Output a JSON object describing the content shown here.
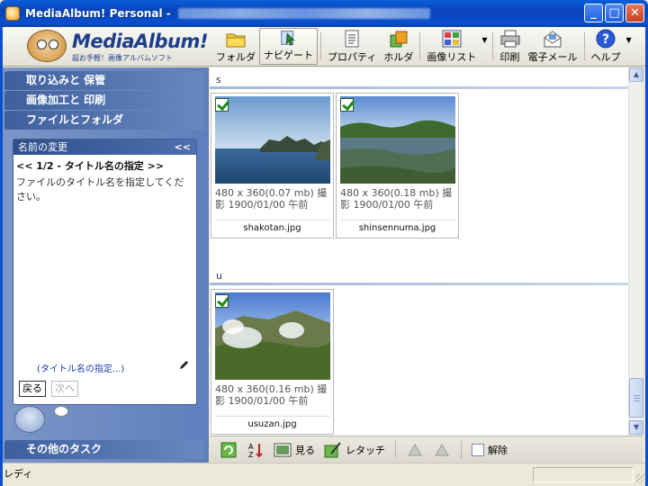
{
  "window": {
    "title": "MediaAlbum! Personal -",
    "minimize": "_",
    "maximize": "□",
    "close": "✕"
  },
  "logo": {
    "text": "MediaAlbum!",
    "subtitle": "超お手軽！画像アルバムソフト"
  },
  "toolbar": {
    "folder": "フォルダ",
    "navigate": "ナビゲート",
    "properties": "プロパティ",
    "holder": "ホルダ",
    "image_list": "画像リスト",
    "print": "印刷",
    "email": "電子メール",
    "help": "ヘルプ"
  },
  "taskpane": {
    "sections": [
      "取り込みと 保管",
      "画像加工と 印刷",
      "ファイルとフォルダ"
    ],
    "subpanel": {
      "title": "名前の変更",
      "collapse": "<<",
      "step_title": "<< 1/2 - タイトル名の指定 >>",
      "step_desc": "ファイルのタイトル名を指定してください。",
      "link": "(タイトル名の指定...)",
      "back": "戻る",
      "next": "次へ"
    },
    "other_tasks": "その他のタスク"
  },
  "gallery": {
    "groups": [
      {
        "label": "s",
        "items": [
          {
            "info": "480 x 360(0.07 mb) 撮影 1900/01/00 午前",
            "name": "shakotan.jpg"
          },
          {
            "info": "480 x 360(0.18 mb) 撮影 1900/01/00 午前",
            "name": "shinsennuma.jpg"
          }
        ]
      },
      {
        "label": "u",
        "items": [
          {
            "info": "480 x 360(0.16 mb) 撮影 1900/01/00 午前",
            "name": "usuzan.jpg"
          }
        ]
      }
    ]
  },
  "bottombar": {
    "view": "見る",
    "retouch": "レタッチ",
    "release": "解除"
  },
  "statusbar": {
    "text": "レディ"
  },
  "colors": {
    "titlebar": "#0a4fcf",
    "taskpane": "#6a88c0",
    "group_line": "#a6b8d8"
  }
}
